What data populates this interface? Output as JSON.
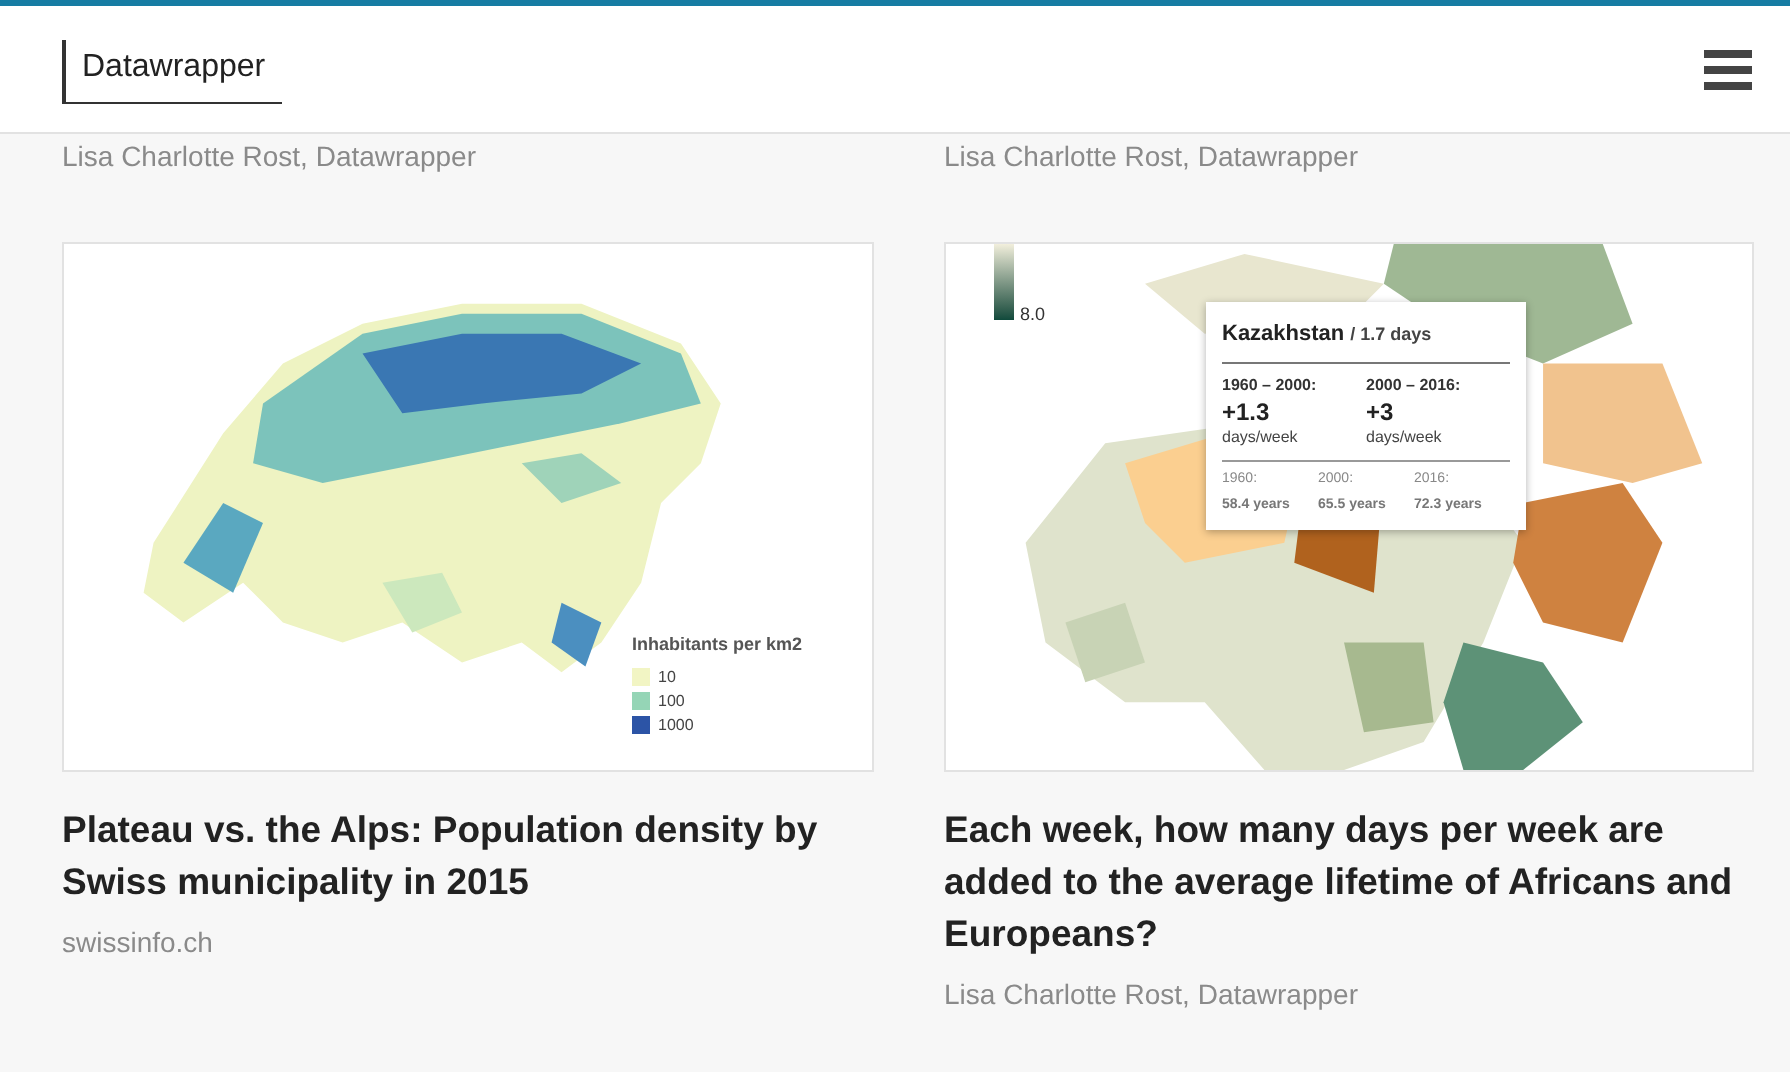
{
  "header": {
    "logo": "Datawrapper"
  },
  "columns": [
    {
      "author": "Lisa Charlotte Rost, Datawrapper",
      "card": {
        "kind": "swiss",
        "legend": {
          "title": "Inhabitants per km2",
          "items": [
            {
              "label": "10",
              "color": "#f2f5c4"
            },
            {
              "label": "100",
              "color": "#95d5b6"
            },
            {
              "label": "1000",
              "color": "#2c54a6"
            }
          ]
        }
      },
      "title": "Plateau vs. the Alps: Population density by Swiss municipality in 2015",
      "source": "swissinfo.ch"
    },
    {
      "author": "Lisa Charlotte Rost, Datawrapper",
      "card": {
        "kind": "africa",
        "scale_label": "8.0",
        "tooltip": {
          "country": "Kazakhstan",
          "subtitle": "/ 1.7 days",
          "periods": [
            {
              "label": "1960 – 2000:",
              "value": "+1.3",
              "unit": "days/week"
            },
            {
              "label": "2000 – 2016:",
              "value": "+3",
              "unit": "days/week"
            }
          ],
          "years": [
            {
              "label": "1960:",
              "value": "58.4 years"
            },
            {
              "label": "2000:",
              "value": "65.5 years"
            },
            {
              "label": "2016:",
              "value": "72.3 years"
            }
          ]
        }
      },
      "title": "Each week, how many days per week are added to the average lifetime of Africans and Europeans?",
      "source": "Lisa Charlotte Rost, Datawrapper"
    }
  ]
}
